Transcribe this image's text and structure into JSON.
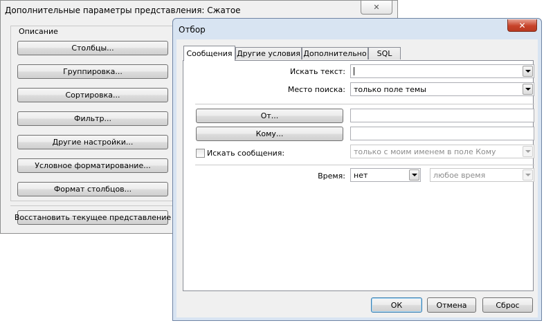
{
  "background_window": {
    "title": "Дополнительные параметры представления: Сжатое",
    "close_glyph": "✕",
    "group_label": "Описание",
    "buttons": [
      "Столбцы...",
      "Группировка...",
      "Сортировка...",
      "Фильтр...",
      "Другие настройки...",
      "Условное форматирование...",
      "Формат столбцов..."
    ],
    "reset_button": "Восстановить текущее представление"
  },
  "filter_dialog": {
    "title": "Отбор",
    "close_glyph": "✕",
    "tabs": [
      "Сообщения",
      "Другие условия",
      "Дополнительно",
      "SQL"
    ],
    "active_tab": "Сообщения",
    "search_text_label": "Искать текст:",
    "search_text_value": "",
    "search_in_label": "Место поиска:",
    "search_in_value": "только поле темы",
    "from_button": "От...",
    "from_value": "",
    "to_button": "Кому...",
    "to_value": "",
    "search_messages_label": "Искать сообщения:",
    "search_messages_checked": false,
    "search_messages_value": "только с моим именем в поле Кому",
    "time_label": "Время:",
    "time_value": "нет",
    "time_range_value": "любое время",
    "ok_button": "ОК",
    "cancel_button": "Отмена",
    "reset_button": "Сброс"
  }
}
